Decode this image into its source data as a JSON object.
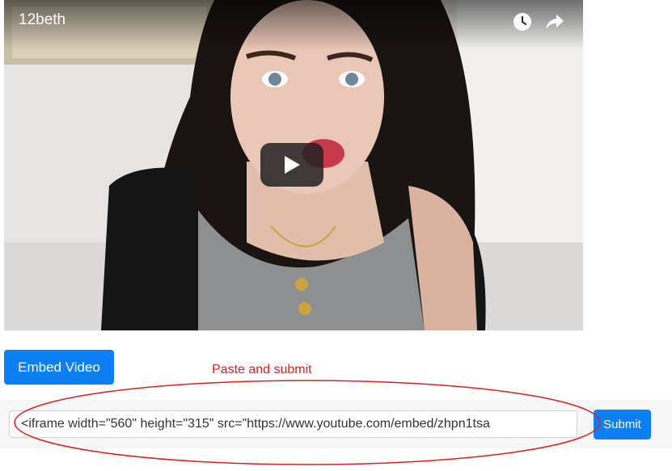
{
  "video": {
    "channel_name": "12beth",
    "icons": {
      "watch_later": "clock-icon",
      "share": "share-icon",
      "play": "play-icon"
    }
  },
  "embed_button": {
    "label": "Embed Video"
  },
  "annotation": {
    "text": "Paste and submit",
    "color": "#e0201a"
  },
  "embed_form": {
    "input_value": "<iframe width=\"560\" height=\"315\" src=\"https://www.youtube.com/embed/zhpn1tsa",
    "submit_label": "Submit"
  },
  "colors": {
    "accent": "#0d7ff5",
    "annotation": "#e0201a"
  }
}
